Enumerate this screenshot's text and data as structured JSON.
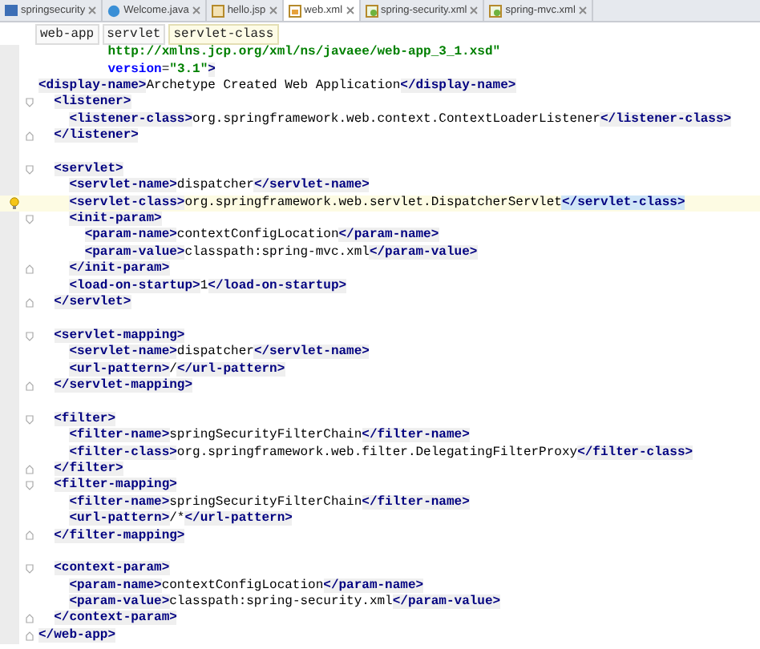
{
  "tabs": [
    {
      "label": "springsecurity",
      "selected": false
    },
    {
      "label": "Welcome.java",
      "selected": false
    },
    {
      "label": "hello.jsp",
      "selected": false
    },
    {
      "label": "web.xml",
      "selected": true
    },
    {
      "label": "spring-security.xml",
      "selected": false
    },
    {
      "label": "spring-mvc.xml",
      "selected": false
    }
  ],
  "breadcrumbs": [
    {
      "label": "web-app",
      "selected": false
    },
    {
      "label": "servlet",
      "selected": false
    },
    {
      "label": "servlet-class",
      "selected": true
    }
  ],
  "lines": [
    {
      "kind": "plain",
      "tokens": [
        {
          "kind": "value",
          "text": "         http://xmlns.jcp.org/xml/ns/javaee/web-app_3_1.xsd\""
        }
      ]
    },
    {
      "kind": "plain",
      "tokens": [
        {
          "kind": "attr",
          "text": "         version"
        },
        {
          "kind": "text",
          "text": "="
        },
        {
          "kind": "value",
          "text": "\"3.1\""
        },
        {
          "kind": "tag",
          "text": ">"
        }
      ]
    },
    {
      "kind": "plain",
      "tokens": [
        {
          "kind": "tag",
          "text": "<display-name>"
        },
        {
          "kind": "text",
          "text": "Archetype Created Web Application"
        },
        {
          "kind": "tag",
          "text": "</display-name>"
        }
      ]
    },
    {
      "kind": "open",
      "tokens": [
        {
          "kind": "tag",
          "text": "  <listener>"
        }
      ]
    },
    {
      "kind": "plain",
      "tokens": [
        {
          "kind": "tag",
          "text": "    <listener-class>"
        },
        {
          "kind": "text",
          "text": "org.springframework.web.context.ContextLoaderListener"
        },
        {
          "kind": "tag",
          "text": "</listener-class>"
        }
      ]
    },
    {
      "kind": "close",
      "tokens": [
        {
          "kind": "tag",
          "text": "  </listener>"
        }
      ]
    },
    {
      "kind": "blank"
    },
    {
      "kind": "open",
      "tokens": [
        {
          "kind": "tag",
          "text": "  <servlet>"
        }
      ]
    },
    {
      "kind": "plain",
      "tokens": [
        {
          "kind": "tag",
          "text": "    <servlet-name>"
        },
        {
          "kind": "text",
          "text": "dispatcher"
        },
        {
          "kind": "tag",
          "text": "</servlet-name>"
        }
      ]
    },
    {
      "kind": "current",
      "tokens": [
        {
          "kind": "tag",
          "text": "    <servlet-class>"
        },
        {
          "kind": "text",
          "text": "org.springframework.web.servlet.DispatcherServlet"
        },
        {
          "kind": "match",
          "text": "</servlet-class>"
        }
      ]
    },
    {
      "kind": "open",
      "tokens": [
        {
          "kind": "tag",
          "text": "    <init-param>"
        }
      ]
    },
    {
      "kind": "plain",
      "tokens": [
        {
          "kind": "tag",
          "text": "      <param-name>"
        },
        {
          "kind": "text",
          "text": "contextConfigLocation"
        },
        {
          "kind": "tag",
          "text": "</param-name>"
        }
      ]
    },
    {
      "kind": "plain",
      "tokens": [
        {
          "kind": "tag",
          "text": "      <param-value>"
        },
        {
          "kind": "text",
          "text": "classpath:spring-mvc.xml"
        },
        {
          "kind": "tag",
          "text": "</param-value>"
        }
      ]
    },
    {
      "kind": "close",
      "tokens": [
        {
          "kind": "tag",
          "text": "    </init-param>"
        }
      ]
    },
    {
      "kind": "plain",
      "tokens": [
        {
          "kind": "tag",
          "text": "    <load-on-startup>"
        },
        {
          "kind": "text",
          "text": "1"
        },
        {
          "kind": "tag",
          "text": "</load-on-startup>"
        }
      ]
    },
    {
      "kind": "close",
      "tokens": [
        {
          "kind": "tag",
          "text": "  </servlet>"
        }
      ]
    },
    {
      "kind": "blank"
    },
    {
      "kind": "open",
      "tokens": [
        {
          "kind": "tag",
          "text": "  <servlet-mapping>"
        }
      ]
    },
    {
      "kind": "plain",
      "tokens": [
        {
          "kind": "tag",
          "text": "    <servlet-name>"
        },
        {
          "kind": "text",
          "text": "dispatcher"
        },
        {
          "kind": "tag",
          "text": "</servlet-name>"
        }
      ]
    },
    {
      "kind": "plain",
      "tokens": [
        {
          "kind": "tag",
          "text": "    <url-pattern>"
        },
        {
          "kind": "text",
          "text": "/"
        },
        {
          "kind": "tag",
          "text": "</url-pattern>"
        }
      ]
    },
    {
      "kind": "close",
      "tokens": [
        {
          "kind": "tag",
          "text": "  </servlet-mapping>"
        }
      ]
    },
    {
      "kind": "blank"
    },
    {
      "kind": "open",
      "tokens": [
        {
          "kind": "tag",
          "text": "  <filter>"
        }
      ]
    },
    {
      "kind": "plain",
      "tokens": [
        {
          "kind": "tag",
          "text": "    <filter-name>"
        },
        {
          "kind": "text",
          "text": "springSecurityFilterChain"
        },
        {
          "kind": "tag",
          "text": "</filter-name>"
        }
      ]
    },
    {
      "kind": "plain",
      "tokens": [
        {
          "kind": "tag",
          "text": "    <filter-class>"
        },
        {
          "kind": "text",
          "text": "org.springframework.web.filter.DelegatingFilterProxy"
        },
        {
          "kind": "tag",
          "text": "</filter-class>"
        }
      ]
    },
    {
      "kind": "close",
      "tokens": [
        {
          "kind": "tag",
          "text": "  </filter>"
        }
      ]
    },
    {
      "kind": "open",
      "tokens": [
        {
          "kind": "tag",
          "text": "  <filter-mapping>"
        }
      ]
    },
    {
      "kind": "plain",
      "tokens": [
        {
          "kind": "tag",
          "text": "    <filter-name>"
        },
        {
          "kind": "text",
          "text": "springSecurityFilterChain"
        },
        {
          "kind": "tag",
          "text": "</filter-name>"
        }
      ]
    },
    {
      "kind": "plain",
      "tokens": [
        {
          "kind": "tag",
          "text": "    <url-pattern>"
        },
        {
          "kind": "text",
          "text": "/*"
        },
        {
          "kind": "tag",
          "text": "</url-pattern>"
        }
      ]
    },
    {
      "kind": "close",
      "tokens": [
        {
          "kind": "tag",
          "text": "  </filter-mapping>"
        }
      ]
    },
    {
      "kind": "blank"
    },
    {
      "kind": "open",
      "tokens": [
        {
          "kind": "tag",
          "text": "  <context-param>"
        }
      ]
    },
    {
      "kind": "plain",
      "tokens": [
        {
          "kind": "tag",
          "text": "    <param-name>"
        },
        {
          "kind": "text",
          "text": "contextConfigLocation"
        },
        {
          "kind": "tag",
          "text": "</param-name>"
        }
      ]
    },
    {
      "kind": "plain",
      "tokens": [
        {
          "kind": "tag",
          "text": "    <param-value>"
        },
        {
          "kind": "text",
          "text": "classpath:spring-security.xml"
        },
        {
          "kind": "tag",
          "text": "</param-value>"
        }
      ]
    },
    {
      "kind": "close",
      "tokens": [
        {
          "kind": "tag",
          "text": "  </context-param>"
        }
      ]
    },
    {
      "kind": "close",
      "tokens": [
        {
          "kind": "tag",
          "text": "</web-app>"
        }
      ]
    }
  ]
}
